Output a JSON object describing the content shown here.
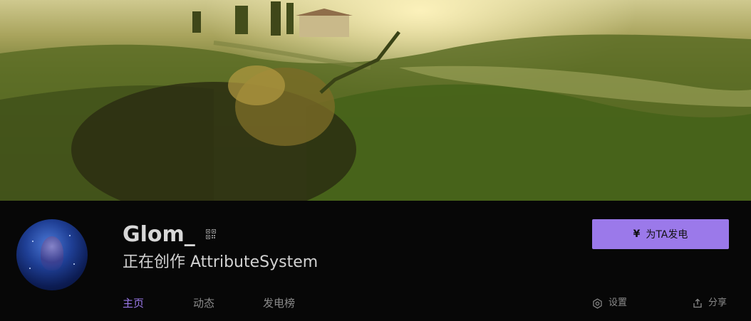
{
  "profile": {
    "name": "Glom_",
    "creating": "正在创作 AttributeSystem"
  },
  "donate": {
    "yen_symbol": "¥",
    "label": "为TA发电"
  },
  "tabs": [
    {
      "label": "主页",
      "active": true
    },
    {
      "label": "动态",
      "active": false
    },
    {
      "label": "发电榜",
      "active": false
    }
  ],
  "actions": {
    "settings_label": "设置",
    "share_label": "分享"
  },
  "colors": {
    "accent": "#9b79ea",
    "background": "#070707"
  },
  "icons": [
    "qr-code-icon",
    "settings-gear-icon",
    "share-icon"
  ]
}
